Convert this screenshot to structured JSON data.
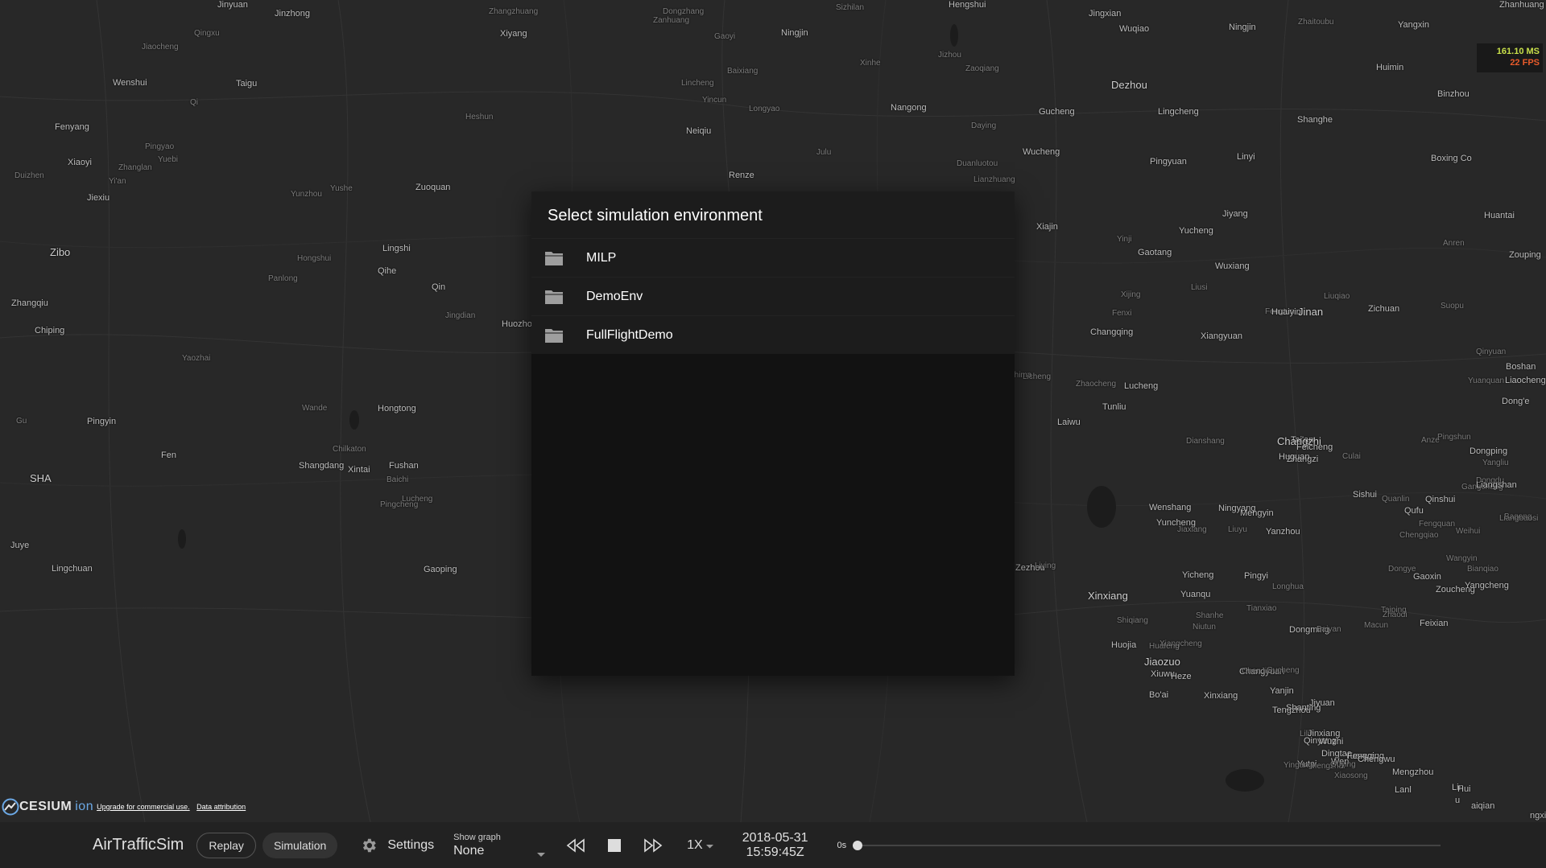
{
  "map": {
    "cities": [
      {
        "name": "Jinyuan",
        "size": "normal"
      },
      {
        "name": "Jinzhong",
        "size": "normal"
      },
      {
        "name": "Zhangzhuang",
        "size": "small"
      },
      {
        "name": "Dongzhang",
        "size": "small"
      },
      {
        "name": "Sizhilan",
        "size": "small"
      },
      {
        "name": "Hengshui",
        "size": "normal"
      },
      {
        "name": "Jingxian",
        "size": "normal"
      },
      {
        "name": "Zhanhuang",
        "size": "normal"
      },
      {
        "name": "Qingxu",
        "size": "small"
      },
      {
        "name": "Zanhuang",
        "size": "small"
      },
      {
        "name": "Gaoyi",
        "size": "small"
      },
      {
        "name": "Xiyang",
        "size": "normal"
      },
      {
        "name": "Ningjin",
        "size": "normal"
      },
      {
        "name": "Wuqiao",
        "size": "normal"
      },
      {
        "name": "Ningjin",
        "size": "normal"
      },
      {
        "name": "Zhaitoubu",
        "size": "small"
      },
      {
        "name": "Yangxin",
        "size": "normal"
      },
      {
        "name": "Jiaocheng",
        "size": "small"
      },
      {
        "name": "Wenshui",
        "size": "normal"
      },
      {
        "name": "Taigu",
        "size": "normal"
      },
      {
        "name": "Baixiang",
        "size": "small"
      },
      {
        "name": "Xinhe",
        "size": "small"
      },
      {
        "name": "Jizhou",
        "size": "small"
      },
      {
        "name": "Zaoqiang",
        "size": "small"
      },
      {
        "name": "Lincheng",
        "size": "small"
      },
      {
        "name": "Dezhou",
        "size": "big"
      },
      {
        "name": "Huimin",
        "size": "normal"
      },
      {
        "name": "Binzhou",
        "size": "normal"
      },
      {
        "name": "Qi",
        "size": "small"
      },
      {
        "name": "Yincun",
        "size": "small"
      },
      {
        "name": "Longyao",
        "size": "small"
      },
      {
        "name": "Nangong",
        "size": "normal"
      },
      {
        "name": "Gucheng",
        "size": "normal"
      },
      {
        "name": "Lingcheng",
        "size": "normal"
      },
      {
        "name": "Heshun",
        "size": "small"
      },
      {
        "name": "Fenyang",
        "size": "normal"
      },
      {
        "name": "Neiqiu",
        "size": "normal"
      },
      {
        "name": "Daying",
        "size": "small"
      },
      {
        "name": "Shanghe",
        "size": "normal"
      },
      {
        "name": "Pingyao",
        "size": "small"
      },
      {
        "name": "Yuebi",
        "size": "small"
      },
      {
        "name": "Julu",
        "size": "small"
      },
      {
        "name": "Wucheng",
        "size": "normal"
      },
      {
        "name": "Linyi",
        "size": "normal"
      },
      {
        "name": "Xiaoyi",
        "size": "normal"
      },
      {
        "name": "Zhanglan",
        "size": "small"
      },
      {
        "name": "Duanluotou",
        "size": "small"
      },
      {
        "name": "Pingyuan",
        "size": "normal"
      },
      {
        "name": "Duizhen",
        "size": "small"
      },
      {
        "name": "Yi'an",
        "size": "small"
      },
      {
        "name": "Renze",
        "size": "normal"
      },
      {
        "name": "Lianzhuang",
        "size": "small"
      },
      {
        "name": "Boxing Co",
        "size": "normal"
      },
      {
        "name": "Zuoquan",
        "size": "normal"
      },
      {
        "name": "Jiexiu",
        "size": "normal"
      },
      {
        "name": "Yunzhou",
        "size": "small"
      },
      {
        "name": "Yushe",
        "size": "small"
      },
      {
        "name": "Huantai",
        "size": "normal"
      },
      {
        "name": "Jiyang",
        "size": "normal"
      },
      {
        "name": "Xiajin",
        "size": "normal"
      },
      {
        "name": "Yucheng",
        "size": "normal"
      },
      {
        "name": "Yinji",
        "size": "small"
      },
      {
        "name": "Gaotang",
        "size": "normal"
      },
      {
        "name": "Anren",
        "size": "small"
      },
      {
        "name": "Zouping",
        "size": "normal"
      },
      {
        "name": "Zibo",
        "size": "big"
      },
      {
        "name": "Lingshi",
        "size": "normal"
      },
      {
        "name": "Hongshui",
        "size": "small"
      },
      {
        "name": "Wuxiang",
        "size": "normal"
      },
      {
        "name": "Qihe",
        "size": "normal"
      },
      {
        "name": "Panlong",
        "size": "small"
      },
      {
        "name": "Qin",
        "size": "normal"
      },
      {
        "name": "Xijing",
        "size": "small"
      },
      {
        "name": "Liusi",
        "size": "small"
      },
      {
        "name": "Liuqiao",
        "size": "small"
      },
      {
        "name": "Zhangqiu",
        "size": "normal"
      },
      {
        "name": "Fenxi",
        "size": "small"
      },
      {
        "name": "Fengtun",
        "size": "small"
      },
      {
        "name": "Huaiyin",
        "size": "normal"
      },
      {
        "name": "Jinan",
        "size": "big"
      },
      {
        "name": "Zichuan",
        "size": "normal"
      },
      {
        "name": "Suopu",
        "size": "small"
      },
      {
        "name": "Jingdian",
        "size": "small"
      },
      {
        "name": "Huozhou",
        "size": "normal"
      },
      {
        "name": "Chiping",
        "size": "normal"
      },
      {
        "name": "Changqing",
        "size": "normal"
      },
      {
        "name": "Xiangyuan",
        "size": "normal"
      },
      {
        "name": "Qinyuan",
        "size": "small"
      },
      {
        "name": "Licheng",
        "size": "small"
      },
      {
        "name": "Boshan",
        "size": "normal"
      },
      {
        "name": "Liaocheng",
        "size": "normal"
      },
      {
        "name": "Yuanquan",
        "size": "small"
      },
      {
        "name": "Zhaocheng",
        "size": "small"
      },
      {
        "name": "Yaozhai",
        "size": "small"
      },
      {
        "name": "Shima",
        "size": "small"
      },
      {
        "name": "Tunliu",
        "size": "normal"
      },
      {
        "name": "Lucheng",
        "size": "normal"
      },
      {
        "name": "Dong'e",
        "size": "normal"
      },
      {
        "name": "Wande",
        "size": "small"
      },
      {
        "name": "Hongtong",
        "size": "normal"
      },
      {
        "name": "Gu",
        "size": "small"
      },
      {
        "name": "Pingyin",
        "size": "normal"
      },
      {
        "name": "Laiwu",
        "size": "normal"
      },
      {
        "name": "Tai'an",
        "size": "normal"
      },
      {
        "name": "Changzhi",
        "size": "big"
      },
      {
        "name": "Pingshun",
        "size": "small"
      },
      {
        "name": "Feicheng",
        "size": "normal"
      },
      {
        "name": "Chilkaton",
        "size": "small"
      },
      {
        "name": "Anze",
        "size": "small"
      },
      {
        "name": "Zhangzi",
        "size": "normal"
      },
      {
        "name": "Huguan",
        "size": "normal"
      },
      {
        "name": "Culai",
        "size": "small"
      },
      {
        "name": "Gangcheng",
        "size": "small"
      },
      {
        "name": "Fen",
        "size": "normal"
      },
      {
        "name": "Shangdang",
        "size": "normal"
      },
      {
        "name": "Fushan",
        "size": "normal"
      },
      {
        "name": "Dianshang",
        "size": "small"
      },
      {
        "name": "Dongping",
        "size": "normal"
      },
      {
        "name": "Yangliu",
        "size": "small"
      },
      {
        "name": "Xintai",
        "size": "normal"
      },
      {
        "name": "SHA",
        "size": "big"
      },
      {
        "name": "Baichi",
        "size": "small"
      },
      {
        "name": "Dongdu",
        "size": "small"
      },
      {
        "name": "Pingcheng",
        "size": "small"
      },
      {
        "name": "Gaoping",
        "size": "normal"
      },
      {
        "name": "Lingchuan",
        "size": "normal"
      },
      {
        "name": "Yicheng",
        "size": "normal"
      },
      {
        "name": "Longhua",
        "size": "small"
      },
      {
        "name": "Liangshan",
        "size": "normal"
      },
      {
        "name": "Ningyang",
        "size": "normal"
      },
      {
        "name": "Mengyin",
        "size": "normal"
      },
      {
        "name": "Qinshui",
        "size": "normal"
      },
      {
        "name": "Lucheng",
        "size": "small"
      },
      {
        "name": "Wenshang",
        "size": "normal"
      },
      {
        "name": "Sishui",
        "size": "normal"
      },
      {
        "name": "Quanlin",
        "size": "small"
      },
      {
        "name": "Bagong",
        "size": "small"
      },
      {
        "name": "Qufu",
        "size": "normal"
      },
      {
        "name": "Liangbaosi",
        "size": "small"
      },
      {
        "name": "Yuncheng",
        "size": "normal"
      },
      {
        "name": "Yanzhou",
        "size": "normal"
      },
      {
        "name": "Pingyi",
        "size": "normal"
      },
      {
        "name": "Gaoxin",
        "size": "normal"
      },
      {
        "name": "Zoucheng",
        "size": "normal"
      },
      {
        "name": "Yangcheng",
        "size": "normal"
      },
      {
        "name": "Zezhou",
        "size": "normal"
      },
      {
        "name": "Liying",
        "size": "small"
      },
      {
        "name": "Wangyin",
        "size": "small"
      },
      {
        "name": "Bianqiao",
        "size": "small"
      },
      {
        "name": "Dongye",
        "size": "small"
      },
      {
        "name": "Juye",
        "size": "normal"
      },
      {
        "name": "Jiaxiang",
        "size": "small"
      },
      {
        "name": "Liuyu",
        "size": "small"
      },
      {
        "name": "Fengquan",
        "size": "small"
      },
      {
        "name": "Weihui",
        "size": "small"
      },
      {
        "name": "Chengqiao",
        "size": "small"
      },
      {
        "name": "Yuanqu",
        "size": "normal"
      },
      {
        "name": "Shanhe",
        "size": "small"
      },
      {
        "name": "Tianxiao",
        "size": "small"
      },
      {
        "name": "Taiping",
        "size": "small"
      },
      {
        "name": "Zhaodi",
        "size": "small"
      },
      {
        "name": "Feixian",
        "size": "normal"
      },
      {
        "name": "Xinxiang",
        "size": "big"
      },
      {
        "name": "Shiqiang",
        "size": "small"
      },
      {
        "name": "Xiangcheng",
        "size": "small"
      },
      {
        "name": "Niutun",
        "size": "small"
      },
      {
        "name": "Dongming",
        "size": "normal"
      },
      {
        "name": "Baiyan",
        "size": "small"
      },
      {
        "name": "Macun",
        "size": "small"
      },
      {
        "name": "Huojia",
        "size": "normal"
      },
      {
        "name": "Huafeng",
        "size": "small"
      },
      {
        "name": "Jiaozuo",
        "size": "big"
      },
      {
        "name": "Xiuwu",
        "size": "normal"
      },
      {
        "name": "Heze",
        "size": "normal"
      },
      {
        "name": "Bo'ai",
        "size": "normal"
      },
      {
        "name": "Xinxiang",
        "size": "normal"
      },
      {
        "name": "Changyuan",
        "size": "normal"
      },
      {
        "name": "ChenJizhen",
        "size": "small"
      },
      {
        "name": "Gucheng",
        "size": "small"
      },
      {
        "name": "Yanjin",
        "size": "normal"
      },
      {
        "name": "Tengzhou",
        "size": "normal"
      },
      {
        "name": "Shanting",
        "size": "normal"
      },
      {
        "name": "Jiyuan",
        "size": "normal"
      },
      {
        "name": "Lilin",
        "size": "small"
      },
      {
        "name": "Qinyang",
        "size": "normal"
      },
      {
        "name": "Wuzhi",
        "size": "normal"
      },
      {
        "name": "Jinxiang",
        "size": "normal"
      },
      {
        "name": "Dingtao",
        "size": "normal"
      },
      {
        "name": "Yuanyang",
        "size": "normal"
      },
      {
        "name": "Fengqiu",
        "size": "normal"
      },
      {
        "name": "Yutai",
        "size": "normal"
      },
      {
        "name": "Yingang",
        "size": "small"
      },
      {
        "name": "Mengzhai",
        "size": "small"
      },
      {
        "name": "Wen",
        "size": "normal"
      },
      {
        "name": "Chengwu",
        "size": "normal"
      },
      {
        "name": "Mengzhou",
        "size": "normal"
      },
      {
        "name": "Guying",
        "size": "small"
      },
      {
        "name": "Xiaosong",
        "size": "small"
      },
      {
        "name": "Lanl",
        "size": "normal"
      },
      {
        "name": "Lin",
        "size": "normal"
      },
      {
        "name": "Hui",
        "size": "normal"
      },
      {
        "name": "u",
        "size": "normal"
      },
      {
        "name": "aiqian",
        "size": "normal"
      },
      {
        "name": "ngxian",
        "size": "normal"
      }
    ]
  },
  "performance": {
    "ms": "161.10 MS",
    "fps": "22 FPS"
  },
  "dialog": {
    "title": "Select simulation environment",
    "items": [
      {
        "label": "MILP",
        "icon": "folder-icon"
      },
      {
        "label": "DemoEnv",
        "icon": "folder-icon"
      },
      {
        "label": "FullFlightDemo",
        "icon": "folder-icon"
      }
    ]
  },
  "credits": {
    "logo_text": "CESIUM",
    "logo_suffix": "ion",
    "upgrade_link": "Upgrade for commercial use.",
    "attribution_link": "Data attribution"
  },
  "toolbar": {
    "app_title": "AirTrafficSim",
    "replay_label": "Replay",
    "simulation_label": "Simulation",
    "settings_label": "Settings",
    "graph_caption": "Show graph",
    "graph_value": "None",
    "speed": "1X",
    "date": "2018-05-31",
    "time": "15:59:45Z",
    "elapsed": "0s",
    "timeline_progress": 0
  },
  "colors": {
    "accent_ms": "#c8e04a",
    "accent_fps": "#e85b2b",
    "dialog_bg": "#121212",
    "bar_bg": "#222222"
  }
}
